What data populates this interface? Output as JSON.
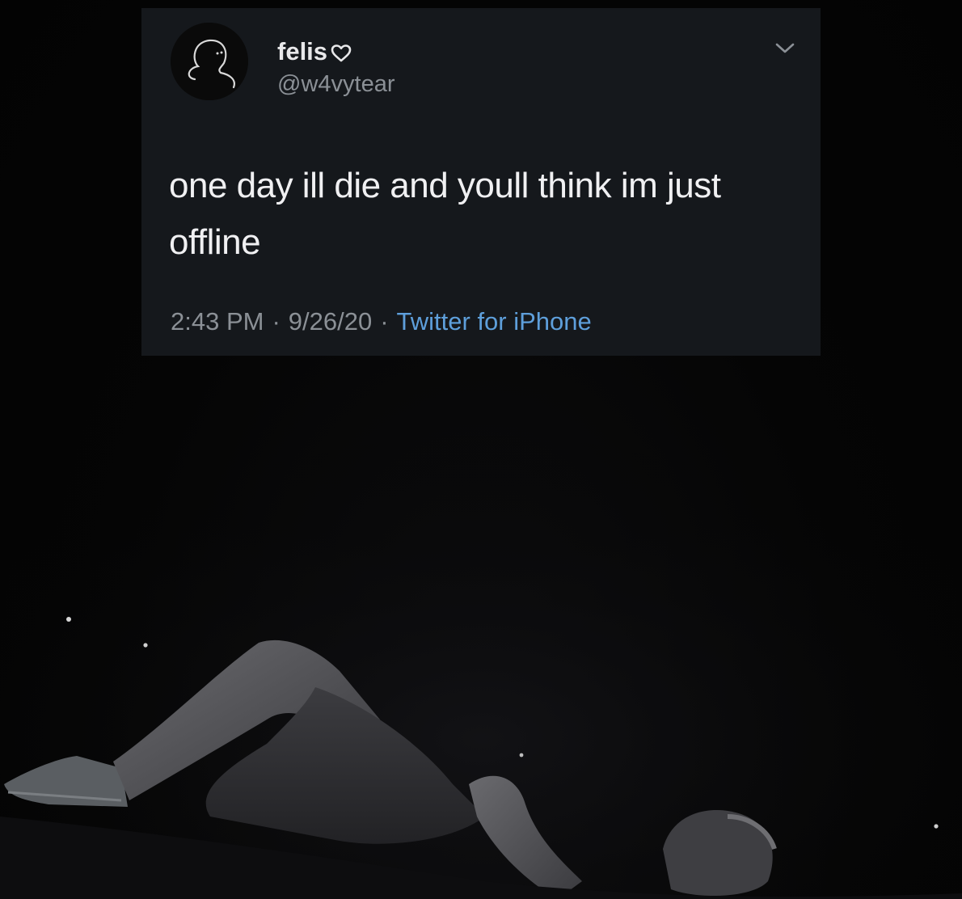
{
  "tweet": {
    "display_name": "felis",
    "handle": "@w4vytear",
    "text": "one day ill die and youll think im just offline",
    "time": "2:43 PM",
    "date": "9/26/20",
    "separator": "·",
    "source": "Twitter for iPhone",
    "icons": {
      "avatar": "default-person-outline-icon",
      "name_badge": "heart-outline-icon",
      "menu": "chevron-down-icon"
    }
  },
  "colors": {
    "card_background": "#15181c",
    "primary_text": "#f0f0f2",
    "secondary_text": "#8b9096",
    "link": "#5e9fdb",
    "page_background": "#050505"
  }
}
